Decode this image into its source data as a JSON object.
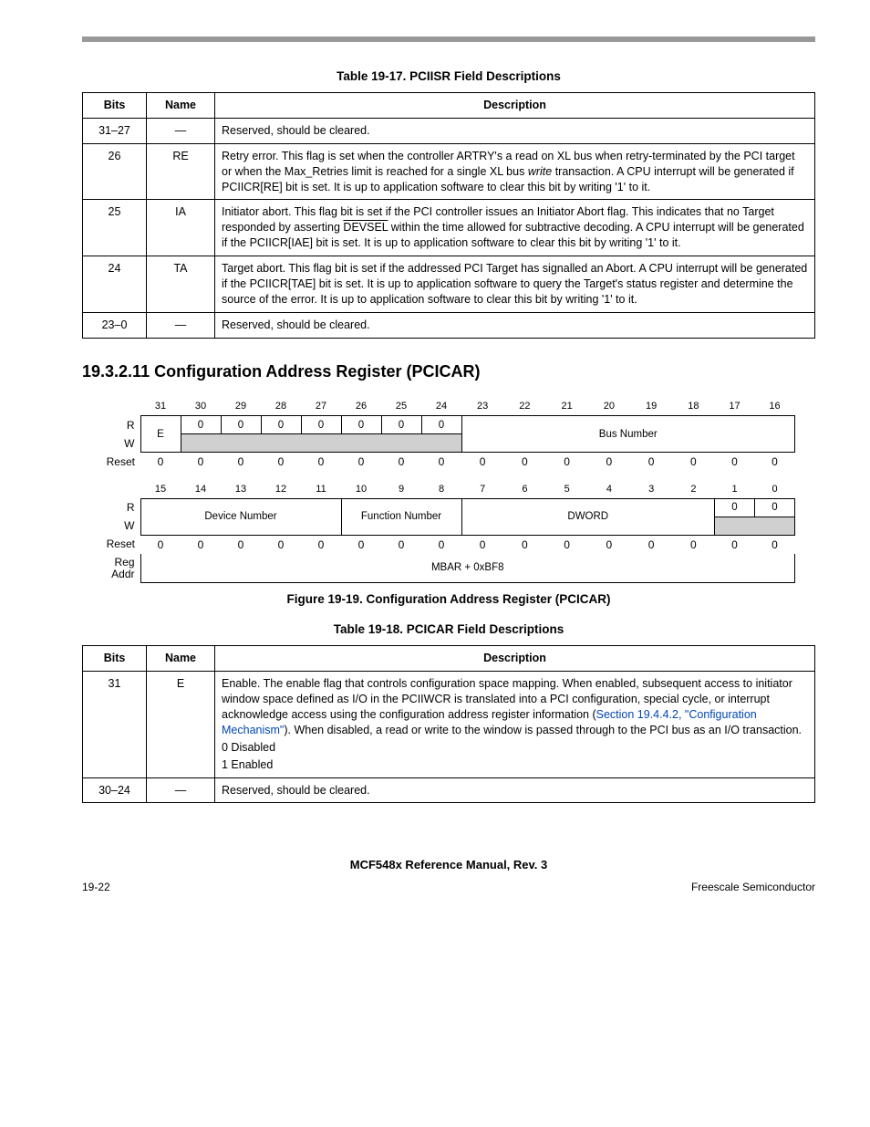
{
  "table17": {
    "caption": "Table 19-17. PCIISR Field Descriptions",
    "headers": {
      "bits": "Bits",
      "name": "Name",
      "desc": "Description"
    },
    "rows": [
      {
        "bits": "31–27",
        "name": "—",
        "desc": "Reserved, should be cleared."
      },
      {
        "bits": "26",
        "name": "RE",
        "desc_pre": "Retry error. This flag is set when the controller ARTRY's a read on XL bus when retry-terminated by the PCI target or when the Max_Retries limit is reached for a single XL bus ",
        "desc_ital": "write",
        "desc_post": " transaction. A CPU interrupt will be generated if PCIICR[RE] bit is set. It is up to application software to clear this bit by writing '1' to it."
      },
      {
        "bits": "25",
        "name": "IA",
        "desc_pre": "Initiator abort. This flag bit is set if the PCI controller issues an Initiator Abort flag. This indicates that no Target responded by asserting ",
        "desc_over": "DEVSEL",
        "desc_post": " within the time allowed for subtractive decoding. A CPU interrupt will be generated if the PCIICR[IAE] bit is set. It is up to application software to clear this bit by writing '1' to it."
      },
      {
        "bits": "24",
        "name": "TA",
        "desc": "Target abort. This flag bit is set if the addressed PCI Target has signalled an Abort. A CPU interrupt will be generated if the PCIICR[TAE] bit is set. It is up to application software to query the Target's status register and determine the source of the error. It is up to application software to clear this bit by writing '1' to it."
      },
      {
        "bits": "23–0",
        "name": "—",
        "desc": "Reserved, should be cleared."
      }
    ]
  },
  "section": {
    "num": "19.3.2.11",
    "title": "Configuration Address Register (PCICAR)"
  },
  "regfig": {
    "caption": "Figure 19-19. Configuration Address Register (PCICAR)",
    "bitnums_hi": [
      "31",
      "30",
      "29",
      "28",
      "27",
      "26",
      "25",
      "24",
      "23",
      "22",
      "21",
      "20",
      "19",
      "18",
      "17",
      "16"
    ],
    "bitnums_lo": [
      "15",
      "14",
      "13",
      "12",
      "11",
      "10",
      "9",
      "8",
      "7",
      "6",
      "5",
      "4",
      "3",
      "2",
      "1",
      "0"
    ],
    "labels": {
      "R": "R",
      "W": "W",
      "Reset": "Reset",
      "RegAddr": "Reg\nAddr"
    },
    "row1_r": {
      "e": "E",
      "zeros": [
        "0",
        "0",
        "0",
        "0",
        "0",
        "0",
        "0"
      ],
      "busnum": "Bus Number"
    },
    "reset_hi": [
      "0",
      "0",
      "0",
      "0",
      "0",
      "0",
      "0",
      "0",
      "0",
      "0",
      "0",
      "0",
      "0",
      "0",
      "0",
      "0"
    ],
    "row2_r": {
      "devnum": "Device Number",
      "funcnum": "Function Number",
      "dword": "DWORD",
      "z1": "0",
      "z0": "0"
    },
    "reset_lo": [
      "0",
      "0",
      "0",
      "0",
      "0",
      "0",
      "0",
      "0",
      "0",
      "0",
      "0",
      "0",
      "0",
      "0",
      "0",
      "0"
    ],
    "regaddr": "MBAR + 0xBF8"
  },
  "table18": {
    "caption": "Table 19-18.  PCICAR Field Descriptions",
    "headers": {
      "bits": "Bits",
      "name": "Name",
      "desc": "Description"
    },
    "rows": {
      "e": {
        "bits": "31",
        "name": "E",
        "pre": "Enable. The enable flag that controls configuration space mapping. When enabled, subsequent access to initiator window space defined as I/O in the PCIIWCR is translated into a PCI configuration, special cycle, or interrupt acknowledge access using the configuration address register information (",
        "link": "Section 19.4.4.2, \"Configuration Mechanism\"",
        "post": "). When disabled, a read or write to the window is passed through to the PCI bus as an I/O transaction.",
        "opt0": "0   Disabled",
        "opt1": "1   Enabled"
      },
      "res": {
        "bits": "30–24",
        "name": "—",
        "desc": "Reserved, should be cleared."
      }
    }
  },
  "footer": {
    "center": "MCF548x Reference Manual, Rev. 3",
    "left": "19-22",
    "right": "Freescale Semiconductor"
  }
}
